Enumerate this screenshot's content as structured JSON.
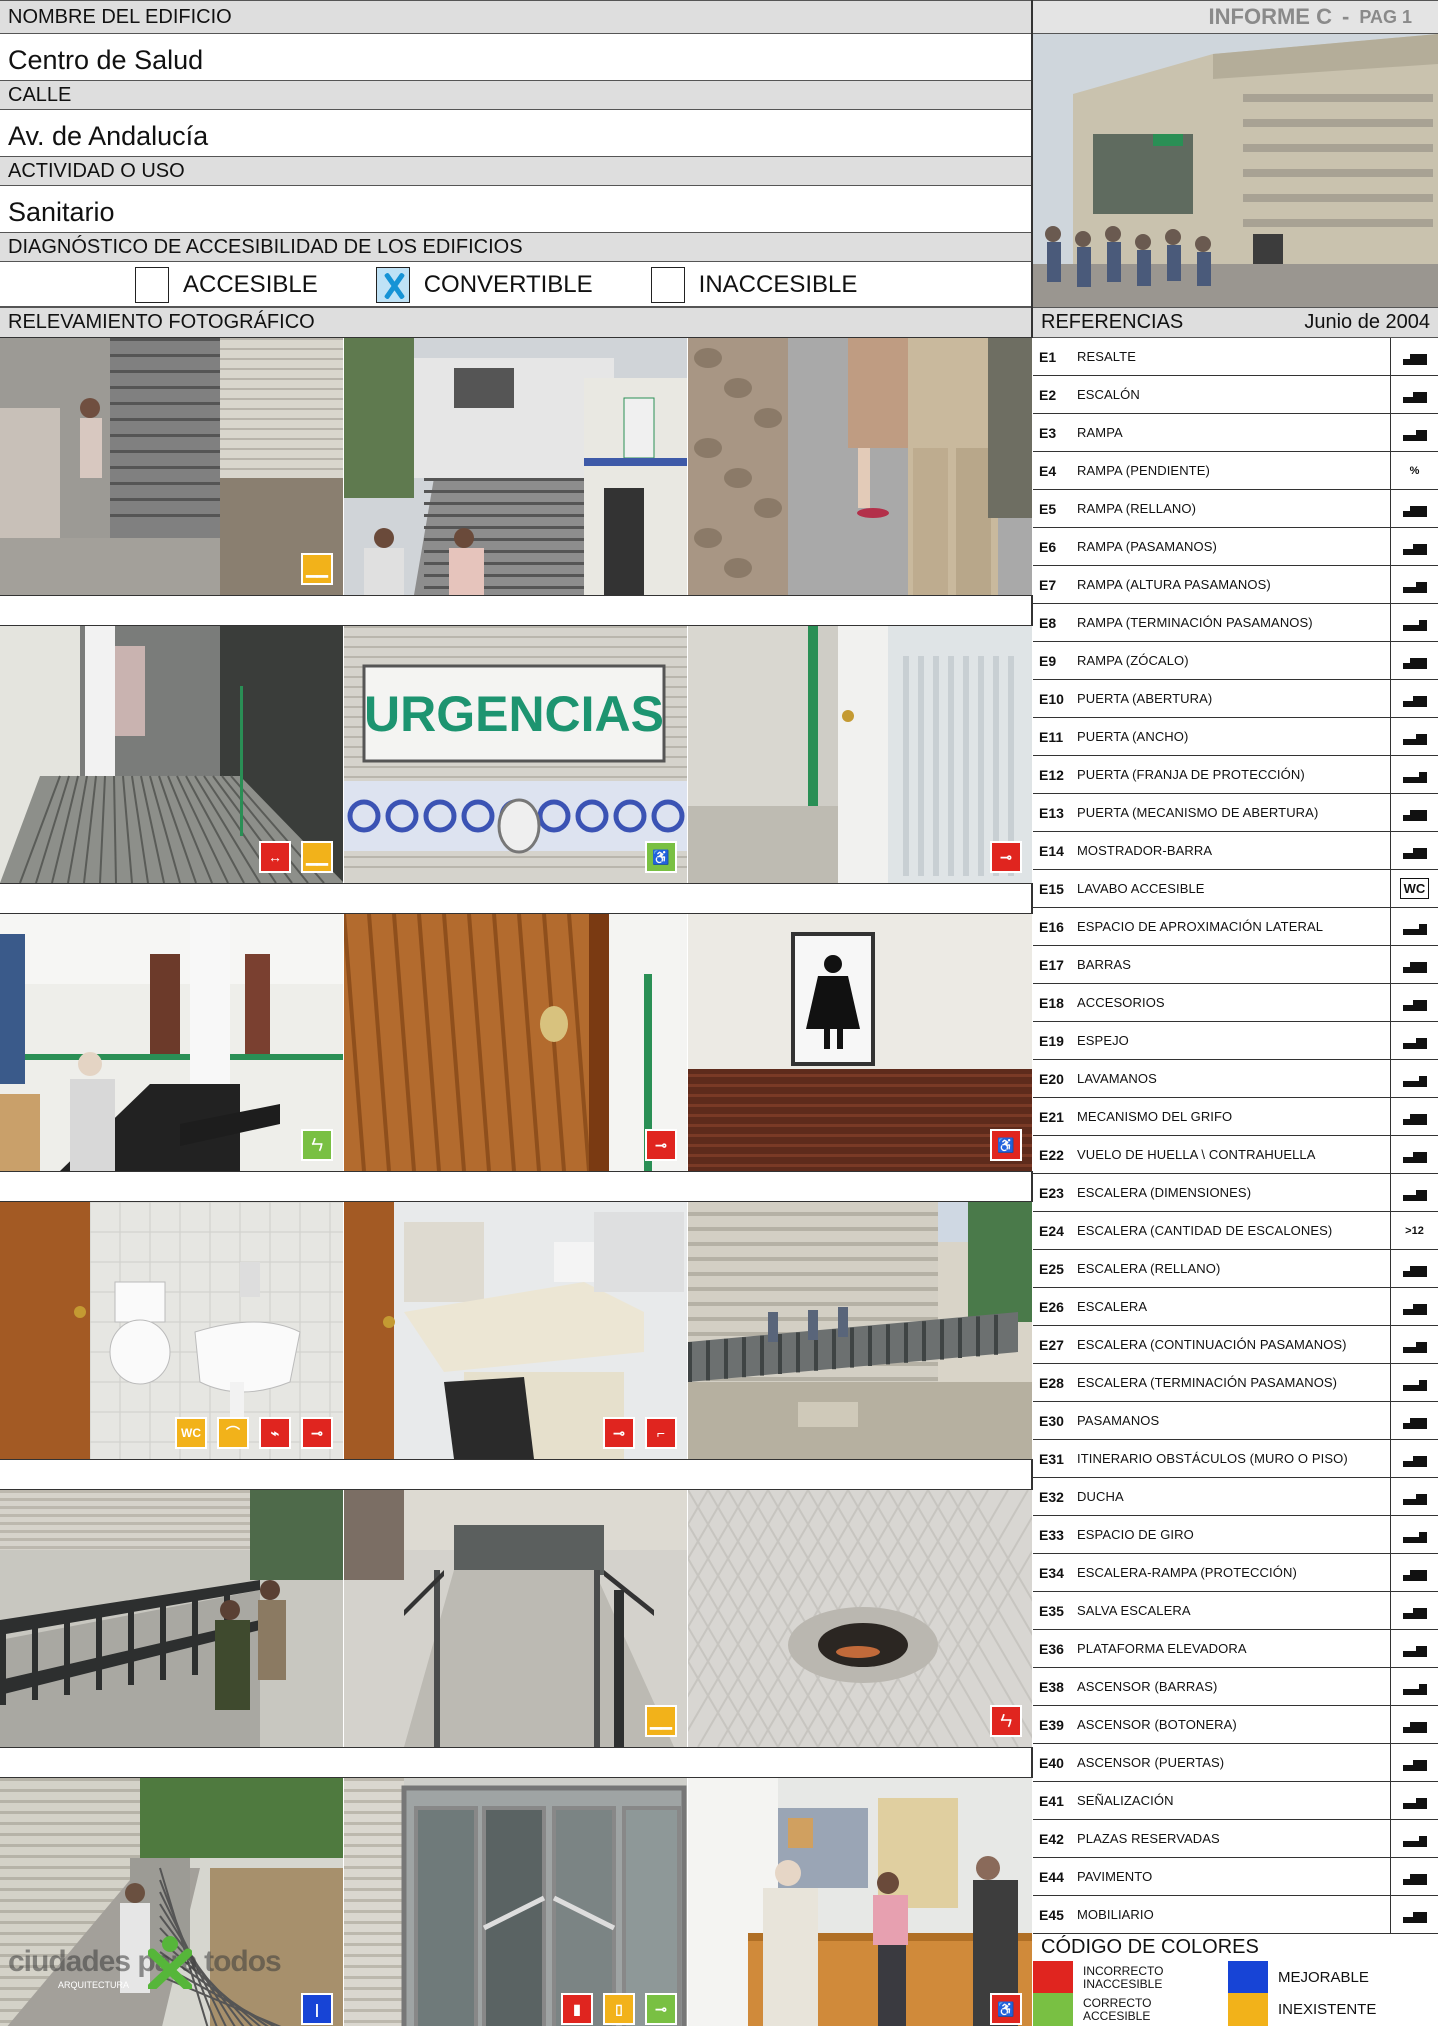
{
  "header": {
    "building_label": "NOMBRE DEL EDIFICIO",
    "building_value": "Centro de Salud",
    "street_label": "CALLE",
    "street_value": "Av. de Andalucía",
    "activity_label": "ACTIVIDAD O USO",
    "activity_value": "Sanitario",
    "diagnosis_label": "DIAGNÓSTICO DE ACCESIBILIDAD DE LOS EDIFICIOS",
    "report_title": "INFORME C",
    "report_dash": "-",
    "report_page": "PAG 1"
  },
  "diagnosis": {
    "options": [
      "ACCESIBLE",
      "CONVERTIBLE",
      "INACCESIBLE"
    ],
    "selected": "CONVERTIBLE"
  },
  "photos_section": {
    "title": "RELEVAMIENTO FOTOGRÁFICO"
  },
  "photos": [
    {
      "scene": "stairs-outdoor",
      "badges": [
        {
          "color": "yellow",
          "icon": "E1"
        }
      ]
    },
    {
      "scene": "stairs-entrance",
      "badges": []
    },
    {
      "scene": "people-legs",
      "badges": []
    },
    {
      "scene": "ramp-door",
      "badges": [
        {
          "color": "red",
          "icon": "E5"
        },
        {
          "color": "yellow",
          "icon": "E1"
        }
      ]
    },
    {
      "scene": "urgencias-sign",
      "sign_text": "URGENCIAS",
      "badges": [
        {
          "color": "green",
          "icon": "E41"
        }
      ]
    },
    {
      "scene": "glass-door",
      "badges": [
        {
          "color": "red",
          "icon": "E13"
        }
      ]
    },
    {
      "scene": "waiting-room",
      "badges": [
        {
          "color": "green",
          "icon": "E31"
        }
      ]
    },
    {
      "scene": "door-knob",
      "badges": [
        {
          "color": "red",
          "icon": "E13"
        }
      ]
    },
    {
      "scene": "restroom-sign",
      "badges": [
        {
          "color": "red",
          "icon": "E41"
        }
      ]
    },
    {
      "scene": "toilet",
      "badges": [
        {
          "color": "yellow",
          "icon": "WC"
        },
        {
          "color": "yellow",
          "icon": "E18"
        },
        {
          "color": "red",
          "icon": "E21"
        },
        {
          "color": "red",
          "icon": "E13"
        }
      ]
    },
    {
      "scene": "office-desk",
      "badges": [
        {
          "color": "red",
          "icon": "E13"
        },
        {
          "color": "red",
          "icon": "E45"
        }
      ]
    },
    {
      "scene": "ramp-building",
      "badges": []
    },
    {
      "scene": "ramp-railings",
      "badges": []
    },
    {
      "scene": "ramp-walkway",
      "badges": [
        {
          "color": "yellow",
          "icon": "E1"
        }
      ]
    },
    {
      "scene": "pavement-hole",
      "badges": [
        {
          "color": "red",
          "icon": "E31"
        }
      ]
    },
    {
      "scene": "ramp-street",
      "badges": [
        {
          "color": "blue",
          "icon": "E30"
        }
      ]
    },
    {
      "scene": "glass-entrance",
      "badges": [
        {
          "color": "red",
          "icon": "E10"
        },
        {
          "color": "yellow",
          "icon": "E12"
        },
        {
          "color": "green",
          "icon": "E13"
        }
      ]
    },
    {
      "scene": "reception",
      "badges": [
        {
          "color": "red",
          "icon": "E14"
        }
      ]
    }
  ],
  "logo_text": "ciudades para todos",
  "logo_sub": "ARQUITECTURA",
  "references": {
    "title": "REFERENCIAS",
    "date": "Junio de 2004",
    "items": [
      {
        "code": "E1",
        "label": "RESALTE"
      },
      {
        "code": "E2",
        "label": "ESCALÓN"
      },
      {
        "code": "E3",
        "label": "RAMPA"
      },
      {
        "code": "E4",
        "label": "RAMPA (PENDIENTE)"
      },
      {
        "code": "E5",
        "label": "RAMPA (RELLANO)"
      },
      {
        "code": "E6",
        "label": "RAMPA (PASAMANOS)"
      },
      {
        "code": "E7",
        "label": "RAMPA (ALTURA PASAMANOS)"
      },
      {
        "code": "E8",
        "label": "RAMPA (TERMINACIÓN PASAMANOS)"
      },
      {
        "code": "E9",
        "label": "RAMPA (ZÓCALO)"
      },
      {
        "code": "E10",
        "label": "PUERTA (ABERTURA)"
      },
      {
        "code": "E11",
        "label": "PUERTA (ANCHO)"
      },
      {
        "code": "E12",
        "label": "PUERTA (FRANJA DE PROTECCIÓN)"
      },
      {
        "code": "E13",
        "label": "PUERTA (MECANISMO DE ABERTURA)"
      },
      {
        "code": "E14",
        "label": "MOSTRADOR-BARRA"
      },
      {
        "code": "E15",
        "label": "LAVABO ACCESIBLE"
      },
      {
        "code": "E16",
        "label": "ESPACIO DE APROXIMACIÓN LATERAL"
      },
      {
        "code": "E17",
        "label": "BARRAS"
      },
      {
        "code": "E18",
        "label": "ACCESORIOS"
      },
      {
        "code": "E19",
        "label": "ESPEJO"
      },
      {
        "code": "E20",
        "label": "LAVAMANOS"
      },
      {
        "code": "E21",
        "label": "MECANISMO DEL GRIFO"
      },
      {
        "code": "E22",
        "label": "VUELO DE HUELLA \\ CONTRAHUELLA"
      },
      {
        "code": "E23",
        "label": "ESCALERA (DIMENSIONES)"
      },
      {
        "code": "E24",
        "label": "ESCALERA (CANTIDAD DE ESCALONES)"
      },
      {
        "code": "E25",
        "label": "ESCALERA (RELLANO)"
      },
      {
        "code": "E26",
        "label": "ESCALERA"
      },
      {
        "code": "E27",
        "label": "ESCALERA (CONTINUACIÓN PASAMANOS)"
      },
      {
        "code": "E28",
        "label": "ESCALERA (TERMINACIÓN PASAMANOS)"
      },
      {
        "code": "E30",
        "label": "PASAMANOS"
      },
      {
        "code": "E31",
        "label": "ITINERARIO OBSTÁCULOS (MURO O PISO)"
      },
      {
        "code": "E32",
        "label": "DUCHA"
      },
      {
        "code": "E33",
        "label": "ESPACIO DE GIRO"
      },
      {
        "code": "E34",
        "label": "ESCALERA-RAMPA (PROTECCIÓN)"
      },
      {
        "code": "E35",
        "label": "SALVA ESCALERA"
      },
      {
        "code": "E36",
        "label": "PLATAFORMA ELEVADORA"
      },
      {
        "code": "E38",
        "label": "ASCENSOR (BARRAS)"
      },
      {
        "code": "E39",
        "label": "ASCENSOR (BOTONERA)"
      },
      {
        "code": "E40",
        "label": "ASCENSOR (PUERTAS)"
      },
      {
        "code": "E41",
        "label": "SEÑALIZACIÓN"
      },
      {
        "code": "E42",
        "label": "PLAZAS RESERVADAS"
      },
      {
        "code": "E44",
        "label": "PAVIMENTO"
      },
      {
        "code": "E45",
        "label": "MOBILIARIO"
      }
    ],
    "icon_text": {
      "E4": "%",
      "E15": "WC",
      "E24": ">12"
    }
  },
  "color_code": {
    "title": "CÓDIGO DE COLORES",
    "entries": [
      {
        "label": "INCORRECTO INACCESIBLE",
        "color": "#e0251f"
      },
      {
        "label": "MEJORABLE",
        "color": "#1744d6"
      },
      {
        "label": "CORRECTO ACCESIBLE",
        "color": "#79c043"
      },
      {
        "label": "INEXISTENTE",
        "color": "#f2b21a"
      }
    ]
  }
}
